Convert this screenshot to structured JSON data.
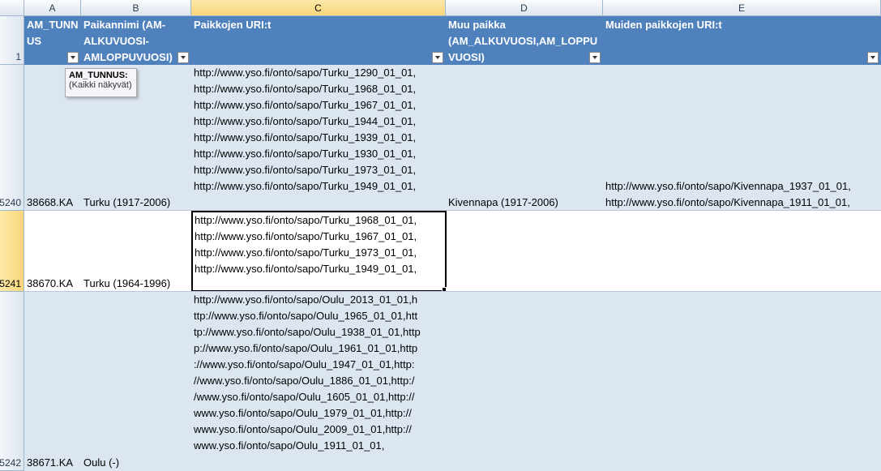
{
  "columns": [
    "A",
    "B",
    "C",
    "D",
    "E"
  ],
  "headers": {
    "a": [
      "AM_TUNN",
      "US"
    ],
    "b": [
      "Paikannimi (AM-",
      "ALKUVUOSI-",
      "AMLOPPUVUOSI)"
    ],
    "c": [
      "Paikkojen URI:t"
    ],
    "d": [
      "Muu paikka",
      "(AM_ALKUVUOSI,AM_LOPPU",
      "VUOSI)"
    ],
    "e": [
      "Muiden paikkojen URI:t"
    ],
    "row_num": "1"
  },
  "rows": [
    {
      "num": "5240",
      "am_tunnus": "38668.KA",
      "paikannimi": "Turku (1917-2006)",
      "uris": [
        "http://www.yso.fi/onto/sapo/Turku_1290_01_01,",
        "http://www.yso.fi/onto/sapo/Turku_1968_01_01,",
        "http://www.yso.fi/onto/sapo/Turku_1967_01_01,",
        "http://www.yso.fi/onto/sapo/Turku_1944_01_01,",
        "http://www.yso.fi/onto/sapo/Turku_1939_01_01,",
        "http://www.yso.fi/onto/sapo/Turku_1930_01_01,",
        "http://www.yso.fi/onto/sapo/Turku_1973_01_01,",
        "http://www.yso.fi/onto/sapo/Turku_1949_01_01,"
      ],
      "muu_paikka": "Kivennapa (1917-2006)",
      "muut_uris": [
        "http://www.yso.fi/onto/sapo/Kivennapa_1937_01_01,",
        "http://www.yso.fi/onto/sapo/Kivennapa_1911_01_01,"
      ]
    },
    {
      "num": "5241",
      "am_tunnus": "38670.KA",
      "paikannimi": "Turku (1964-1996)",
      "uris": [
        "http://www.yso.fi/onto/sapo/Turku_1968_01_01,",
        "http://www.yso.fi/onto/sapo/Turku_1967_01_01,",
        "http://www.yso.fi/onto/sapo/Turku_1973_01_01,",
        "http://www.yso.fi/onto/sapo/Turku_1949_01_01,"
      ],
      "muu_paikka": "",
      "muut_uris": []
    },
    {
      "num": "5242",
      "am_tunnus": "38671.KA",
      "paikannimi": "Oulu (-)",
      "uris": [
        "http://www.yso.fi/onto/sapo/Oulu_2013_01_01,h",
        "ttp://www.yso.fi/onto/sapo/Oulu_1965_01_01,htt",
        "tp://www.yso.fi/onto/sapo/Oulu_1938_01_01,http",
        "p://www.yso.fi/onto/sapo/Oulu_1961_01_01,http",
        "://www.yso.fi/onto/sapo/Oulu_1947_01_01,http:",
        "//www.yso.fi/onto/sapo/Oulu_1886_01_01,http:/",
        "/www.yso.fi/onto/sapo/Oulu_1605_01_01,http://",
        "www.yso.fi/onto/sapo/Oulu_1979_01_01,http://",
        "www.yso.fi/onto/sapo/Oulu_2009_01_01,http://",
        "www.yso.fi/onto/sapo/Oulu_1911_01_01,"
      ],
      "muu_paikka": "",
      "muut_uris": []
    }
  ],
  "tooltip": {
    "title": "AM_TUNNUS:",
    "text": "(Kaikki näkyvät)"
  },
  "colors": {
    "header_blue": "#4f81bd",
    "band": "#dce6f1",
    "selection": "#f9d67a"
  }
}
